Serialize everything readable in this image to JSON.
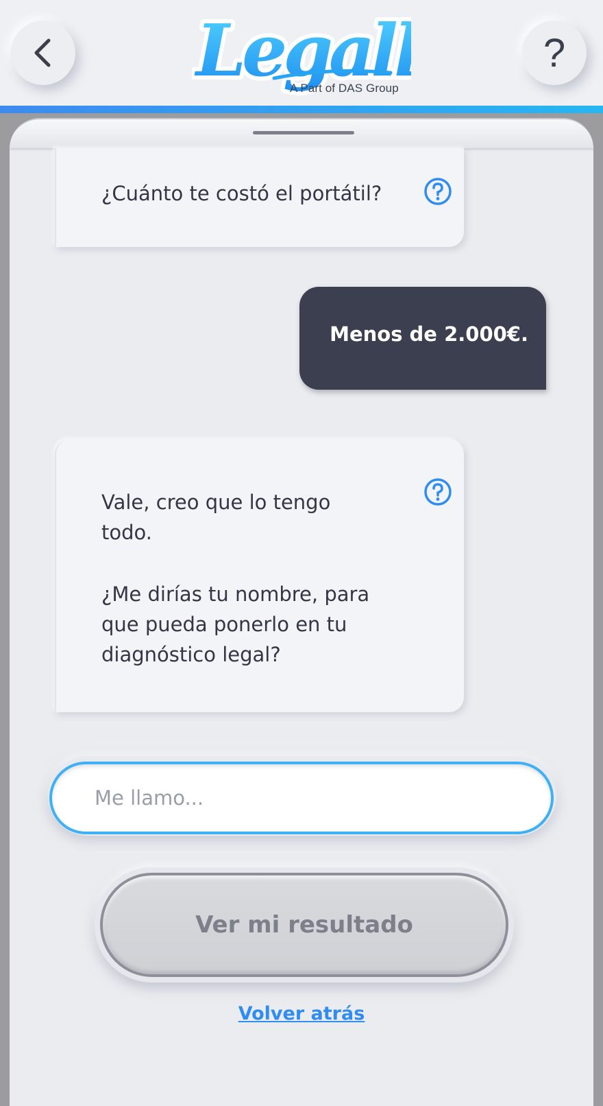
{
  "header": {
    "logo_text": "Legally",
    "logo_subtitle": "A Part of DAS Group",
    "help_label": "?"
  },
  "chat": {
    "messages": [
      {
        "from": "bot",
        "text": "¿Cuánto te costó el portátil?"
      },
      {
        "from": "user",
        "text": "Menos de 2.000€."
      },
      {
        "from": "bot",
        "text_1": "Vale, creo que lo tengo todo.",
        "text_2": "¿Me dirías tu nombre, para que pueda ponerlo en tu diagnóstico legal?"
      }
    ]
  },
  "input": {
    "placeholder": "Me llamo...",
    "value": ""
  },
  "actions": {
    "result_label": "Ver mi resultado",
    "back_label": "Volver atrás"
  },
  "colors": {
    "accent": "#2f8cf0",
    "user_bubble": "#3c3f4f",
    "input_border": "#3fb0f2"
  },
  "icons": {
    "back": "chevron-left-icon",
    "help": "question-icon",
    "info": "question-circle-icon"
  }
}
